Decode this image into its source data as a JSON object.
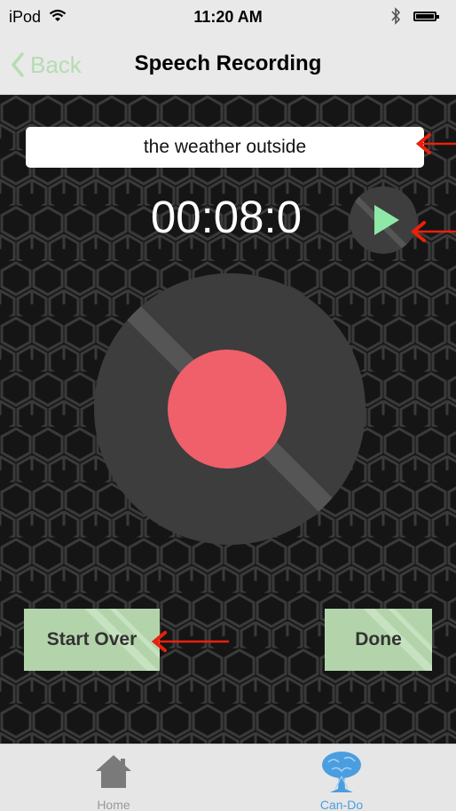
{
  "status_bar": {
    "carrier": "iPod",
    "time": "11:20 AM",
    "icons": [
      "wifi-icon",
      "bluetooth-icon",
      "battery-icon"
    ]
  },
  "nav": {
    "back_label": "Back",
    "title": "Speech Recording"
  },
  "recording": {
    "phrase": "the weather outside",
    "timer": "00:08:0"
  },
  "buttons": {
    "start_over": "Start Over",
    "done": "Done"
  },
  "tabs": [
    {
      "label": "Home",
      "icon": "home-icon",
      "active": false
    },
    {
      "label": "Can-Do",
      "icon": "tree-icon",
      "active": true
    }
  ],
  "colors": {
    "accent_green": "#b3d4ab",
    "record_red": "#f0606a",
    "play_green": "#8ee8a8",
    "active_tab_blue": "#4a9ee0",
    "annotation_arrow": "#e8210c"
  }
}
